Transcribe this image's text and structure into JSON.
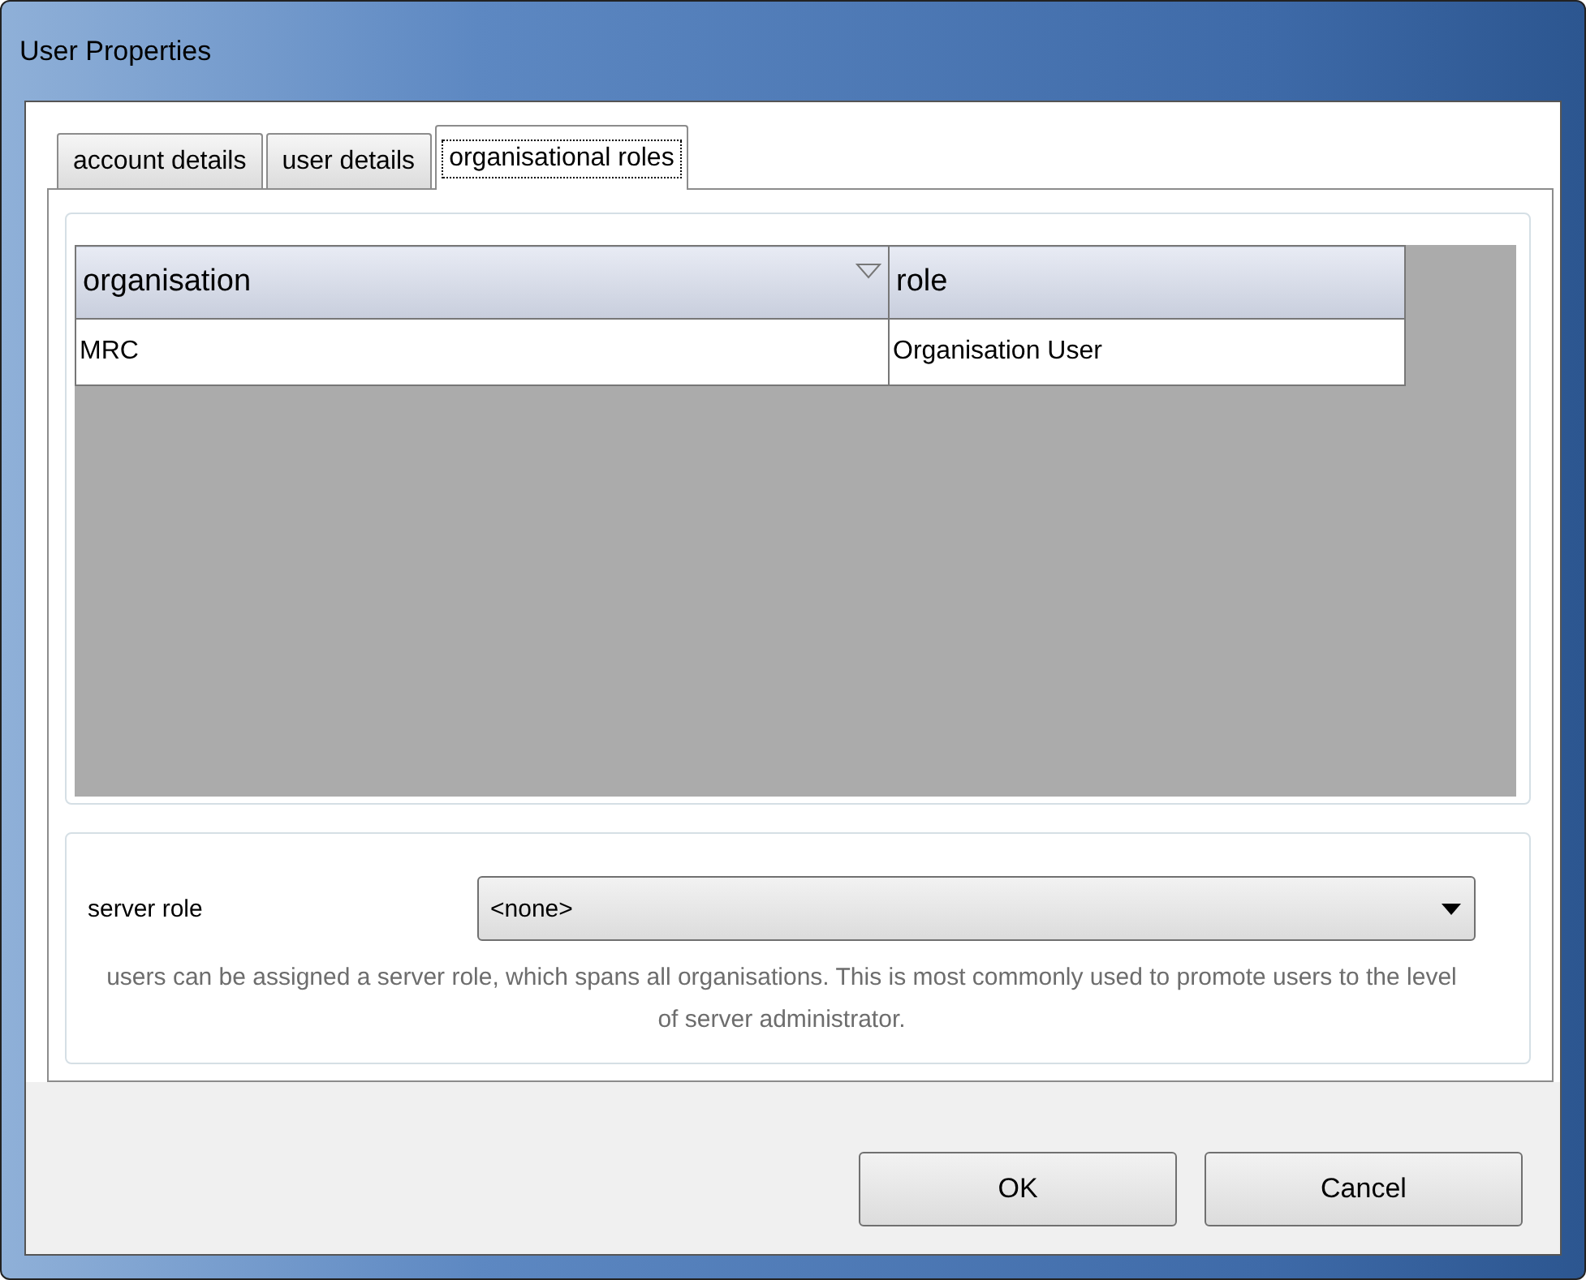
{
  "window": {
    "title": "User Properties"
  },
  "tabs": [
    {
      "label": "account details",
      "selected": false
    },
    {
      "label": "user details",
      "selected": false
    },
    {
      "label": "organisational roles",
      "selected": true
    }
  ],
  "roles_table": {
    "columns": [
      {
        "label": "organisation",
        "sorted": true
      },
      {
        "label": "role",
        "sorted": false
      }
    ],
    "rows": [
      [
        "MRC",
        "Organisation User"
      ]
    ]
  },
  "server_role": {
    "label": "server role",
    "value": "<none>",
    "help": "users can be assigned a server role, which spans all organisations. This is most commonly used to promote users to the level of server administrator."
  },
  "buttons": [
    "OK",
    "Cancel"
  ]
}
